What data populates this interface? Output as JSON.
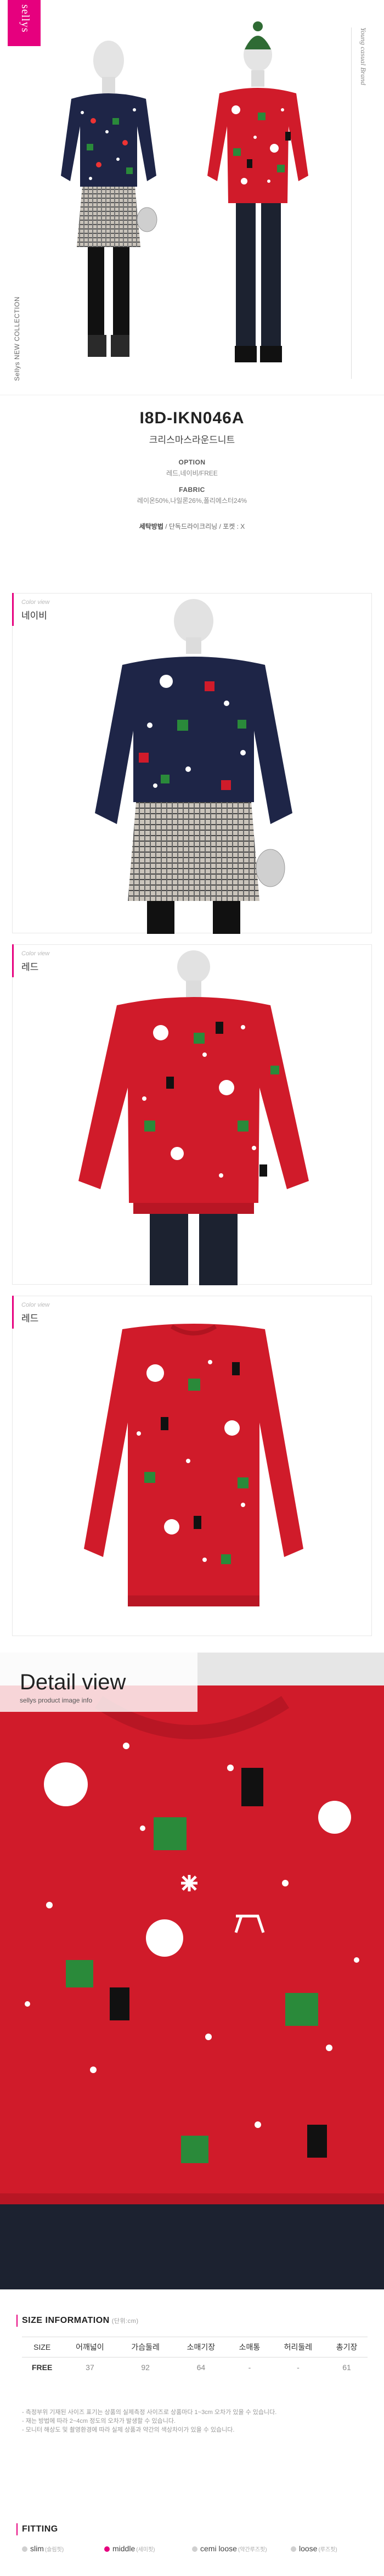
{
  "brand": {
    "logo": "sellys",
    "tagline": "Young casual Brand",
    "collection": "Sellys NEW COLLECTION"
  },
  "product": {
    "code": "I8D-IKN046A",
    "name": "크리스마스라운드니트",
    "option_label": "OPTION",
    "option_value": "레드,네이비/FREE",
    "fabric_label": "FABRIC",
    "fabric_value": "레이온50%,나일론26%,폴리에스터24%",
    "care_label": "세탁방법",
    "care_value": "/ 단독드라이크리닝 / 포켓 : X"
  },
  "color_views": [
    {
      "label": "Color view",
      "name": "네이비"
    },
    {
      "label": "Color view",
      "name": "레드"
    },
    {
      "label": "Color view",
      "name": "레드"
    }
  ],
  "detail": {
    "title": "Detail view",
    "subtitle": "sellys product image info"
  },
  "size_info": {
    "title": "SIZE INFORMATION",
    "unit": "(단위:cm)",
    "headers": [
      "SIZE",
      "어깨넓이",
      "가슴둘레",
      "소매기장",
      "소매통",
      "허리둘레",
      "총기장"
    ],
    "rows": [
      [
        "FREE",
        "37",
        "92",
        "64",
        "-",
        "-",
        "61"
      ]
    ],
    "notes": [
      "- 측정부위 기재된 사이즈 표기는 상품의 실제측정 사이즈로 상품마다 1~3cm 오차가 있을 수 있습니다.",
      "- 재는 방법에 따라 2~4cm 정도의 오차가 발생할 수 있습니다.",
      "- 모니터 해상도 및 촬영환경에 따라 실제 상품과 약간의 색상차이가 있을 수 있습니다."
    ]
  },
  "fitting": {
    "title": "FITTING",
    "options": [
      {
        "label": "slim",
        "sub": "(슬림핏)",
        "selected": false
      },
      {
        "label": "middle",
        "sub": "(세미핏)",
        "selected": true
      },
      {
        "label": "cemi loose",
        "sub": "(약간루즈핏)",
        "selected": false
      },
      {
        "label": "loose",
        "sub": "(루즈핏)",
        "selected": false
      }
    ]
  },
  "colors": {
    "accent": "#e6007e",
    "red_sweater": "#d01b2a",
    "navy_sweater": "#1e2547"
  }
}
